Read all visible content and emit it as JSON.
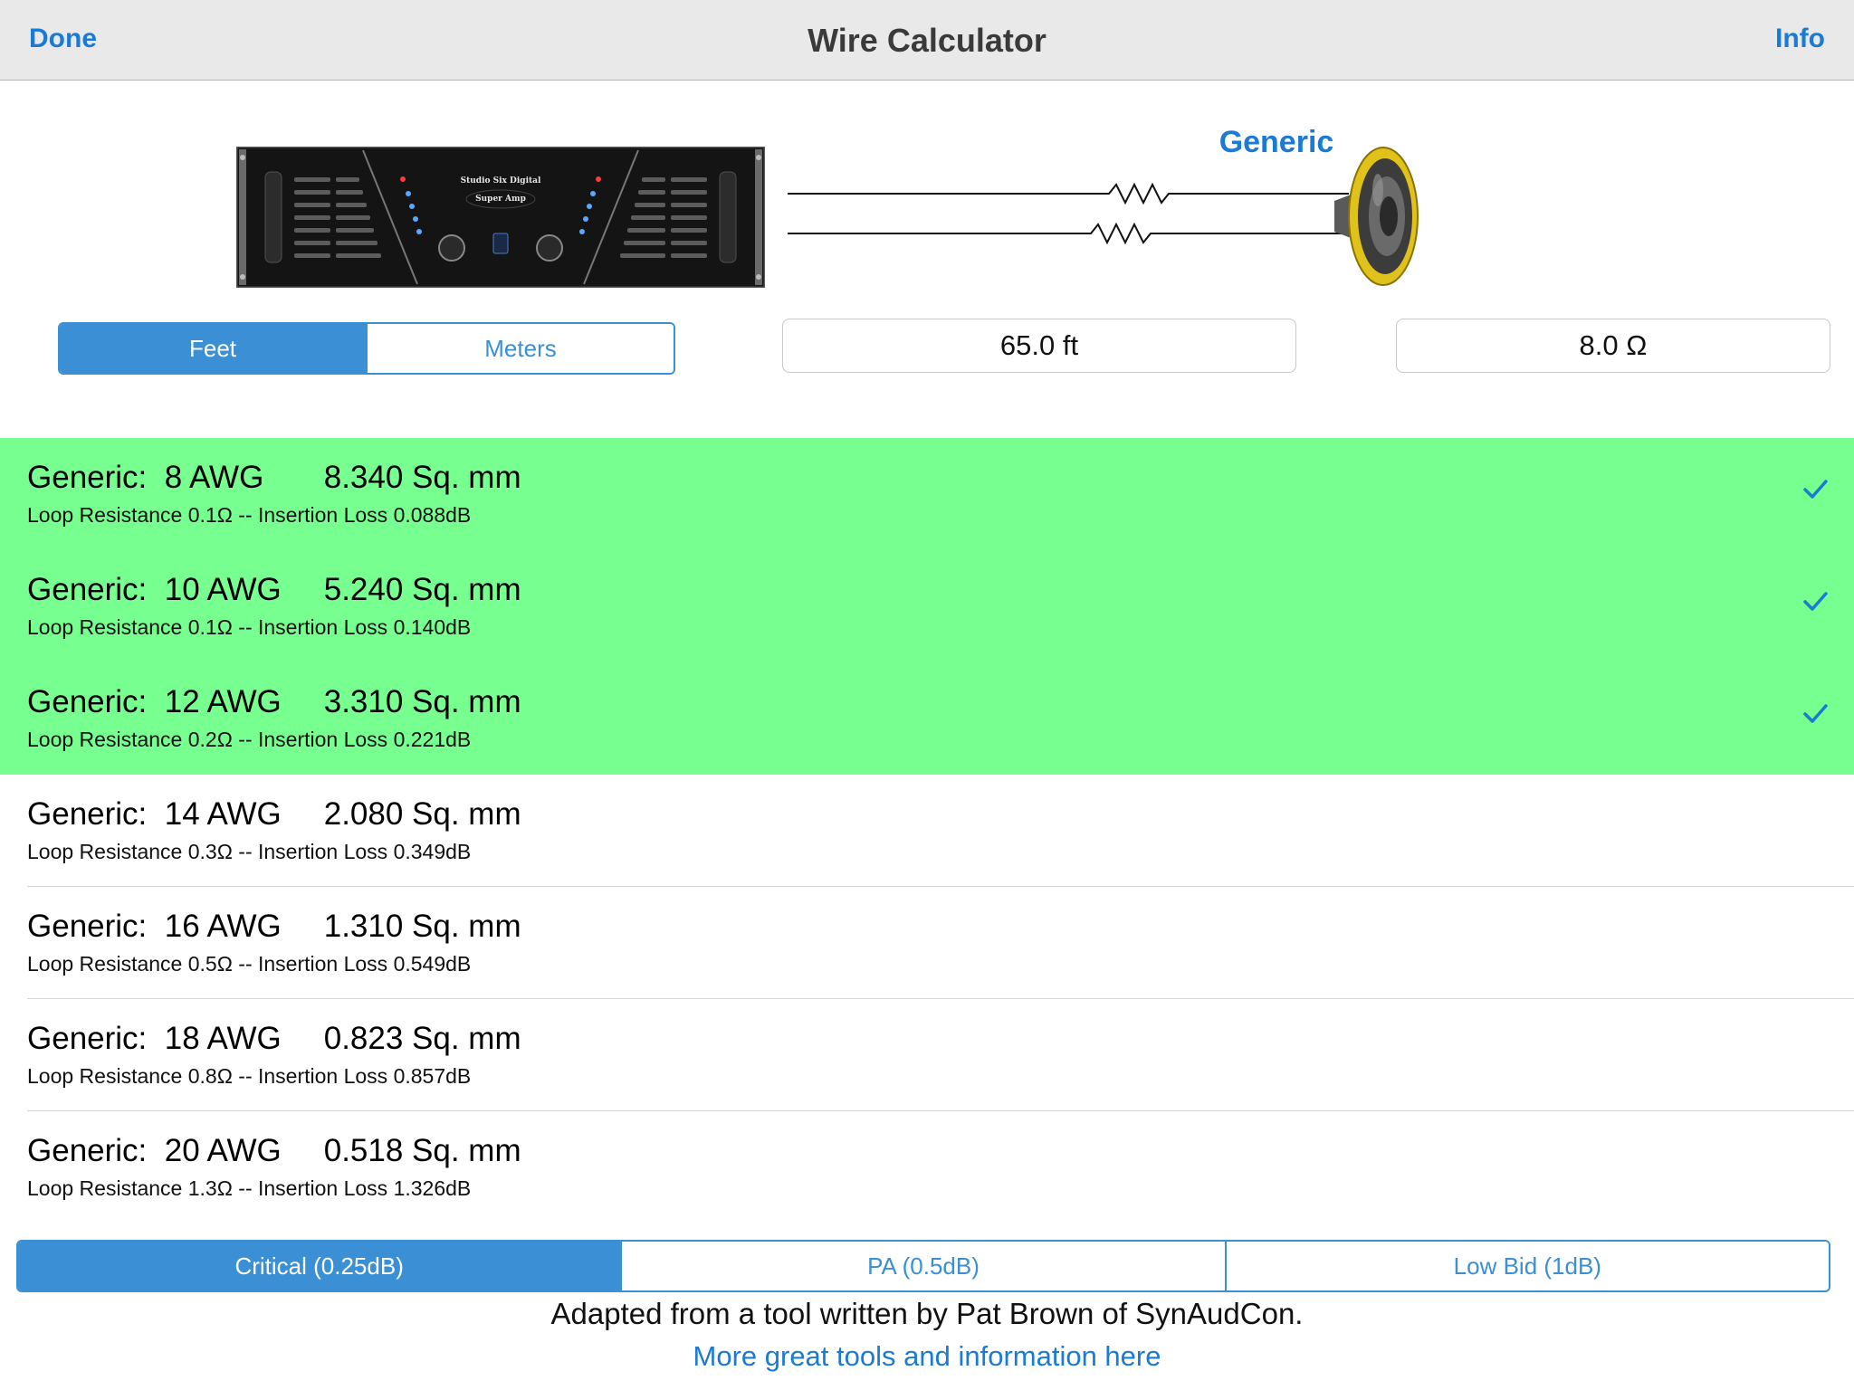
{
  "nav": {
    "done_label": "Done",
    "title": "Wire Calculator",
    "info_label": "Info"
  },
  "amp": {
    "brand": "Studio Six Digital",
    "model": "Super Amp"
  },
  "diagram": {
    "wire_label": "Generic"
  },
  "units": {
    "options": [
      "Feet",
      "Meters"
    ],
    "selected": "Feet"
  },
  "length_value": "65.0 ft",
  "impedance_value": "8.0 Ω",
  "wires": [
    {
      "name": "Generic:",
      "gauge": "8 AWG",
      "area": "8.340 Sq. mm",
      "detail": "Loop Resistance 0.1Ω -- Insertion Loss 0.088dB",
      "highlighted": true
    },
    {
      "name": "Generic:",
      "gauge": "10 AWG",
      "area": "5.240 Sq. mm",
      "detail": "Loop Resistance 0.1Ω -- Insertion Loss 0.140dB",
      "highlighted": true
    },
    {
      "name": "Generic:",
      "gauge": "12 AWG",
      "area": "3.310 Sq. mm",
      "detail": "Loop Resistance 0.2Ω -- Insertion Loss 0.221dB",
      "highlighted": true
    },
    {
      "name": "Generic:",
      "gauge": "14 AWG",
      "area": "2.080 Sq. mm",
      "detail": "Loop Resistance 0.3Ω -- Insertion Loss 0.349dB",
      "highlighted": false
    },
    {
      "name": "Generic:",
      "gauge": "16 AWG",
      "area": "1.310 Sq. mm",
      "detail": "Loop Resistance 0.5Ω -- Insertion Loss 0.549dB",
      "highlighted": false
    },
    {
      "name": "Generic:",
      "gauge": "18 AWG",
      "area": "0.823 Sq. mm",
      "detail": "Loop Resistance 0.8Ω -- Insertion Loss 0.857dB",
      "highlighted": false
    },
    {
      "name": "Generic:",
      "gauge": "20 AWG",
      "area": "0.518 Sq. mm",
      "detail": "Loop Resistance 1.3Ω -- Insertion Loss 1.326dB",
      "highlighted": false
    }
  ],
  "loss_modes": {
    "options": [
      "Critical (0.25dB)",
      "PA (0.5dB)",
      "Low Bid (1dB)"
    ],
    "selected": "Critical (0.25dB)"
  },
  "footer": {
    "credit": "Adapted from a tool written by Pat Brown of SynAudCon.",
    "link": "More great tools and information here"
  },
  "colors": {
    "accent": "#3b8fd4",
    "link": "#1a7ad6",
    "highlight": "#77ff8f",
    "navbar": "#e9e9e9"
  },
  "icons": {
    "check": "checkmark-icon",
    "speaker": "speaker-icon",
    "amplifier": "amplifier-image",
    "resistor": "resistor-icon"
  }
}
